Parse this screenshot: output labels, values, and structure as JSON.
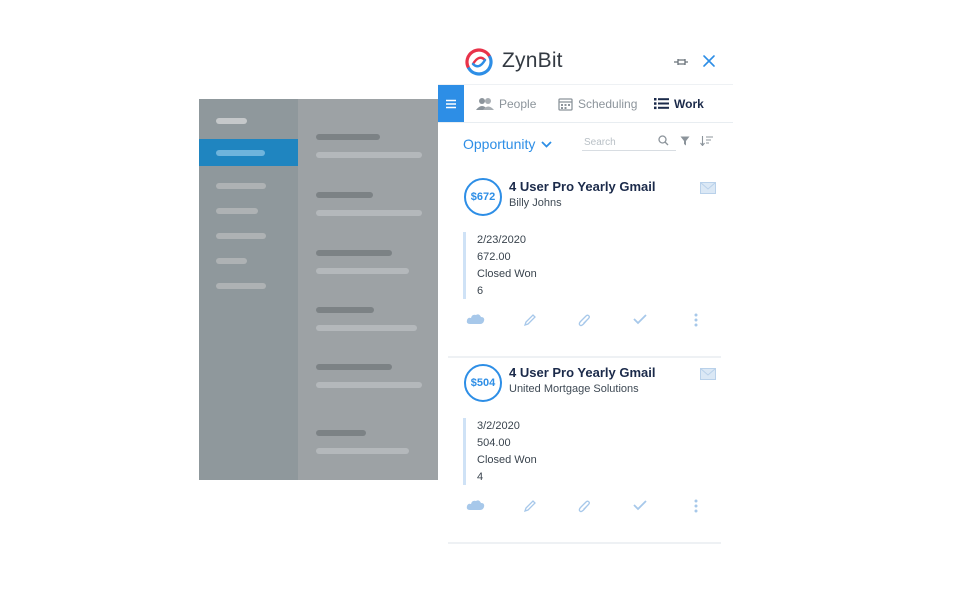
{
  "header": {
    "brand": "ZynBit"
  },
  "tabs": [
    {
      "label": "People"
    },
    {
      "label": "Scheduling"
    },
    {
      "label": "Work"
    }
  ],
  "filter": {
    "dropdown_label": "Opportunity",
    "search_placeholder": "Search"
  },
  "cards": [
    {
      "amount": "$672",
      "title": "4 User Pro Yearly Gmail",
      "account": "Billy Johns",
      "date": "2/23/2020",
      "value": "672.00",
      "stage": "Closed Won",
      "count": "6"
    },
    {
      "amount": "$504",
      "title": "4 User Pro Yearly Gmail",
      "account": "United Mortgage Solutions",
      "date": "3/2/2020",
      "value": "504.00",
      "stage": "Closed Won",
      "count": "4"
    }
  ],
  "colors": {
    "accent": "#2d8ee6",
    "title": "#1b2a4a",
    "brand_red": "#e8334a"
  }
}
